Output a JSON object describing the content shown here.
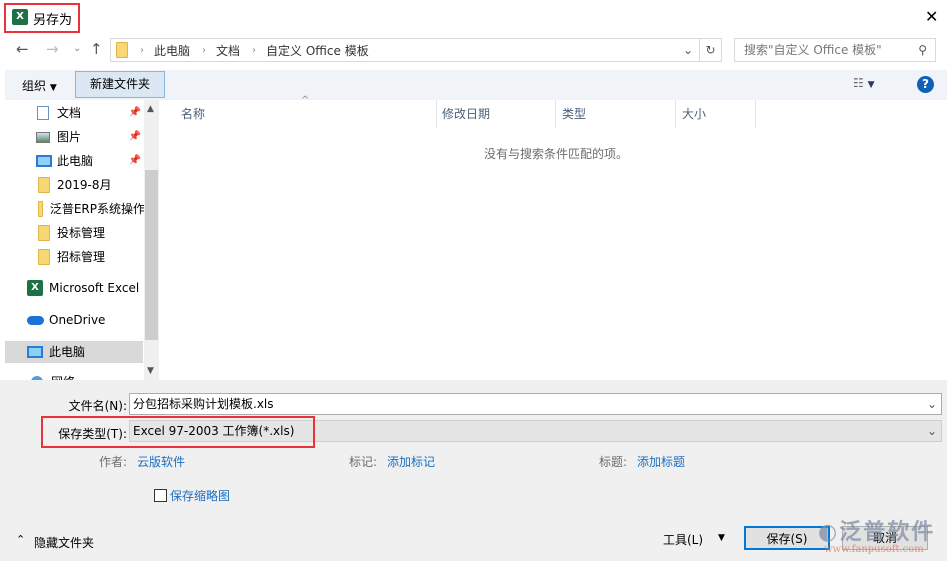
{
  "window": {
    "title": "另存为",
    "close": "✕"
  },
  "address": {
    "crumbs": [
      "此电脑",
      "文档",
      "自定义 Office 模板"
    ],
    "search_placeholder": "搜索\"自定义 Office 模板\""
  },
  "toolbar": {
    "organize": "组织",
    "new_folder": "新建文件夹",
    "help": "?"
  },
  "nav": {
    "items": [
      {
        "label": "文档",
        "icon": "document-icon",
        "pinned": true
      },
      {
        "label": "图片",
        "icon": "picture-icon",
        "pinned": true
      },
      {
        "label": "此电脑",
        "icon": "computer-icon",
        "pinned": true
      },
      {
        "label": "2019-8月",
        "icon": "folder-icon"
      },
      {
        "label": "泛普ERP系统操作",
        "icon": "folder-icon"
      },
      {
        "label": "投标管理",
        "icon": "folder-icon"
      },
      {
        "label": "招标管理",
        "icon": "folder-icon"
      },
      {
        "label": "Microsoft Excel",
        "icon": "excel-icon"
      },
      {
        "label": "OneDrive",
        "icon": "cloud-icon"
      },
      {
        "label": "此电脑",
        "icon": "computer-icon",
        "selected": true
      },
      {
        "label": "网络",
        "icon": "network-icon"
      }
    ]
  },
  "columns": [
    "名称",
    "修改日期",
    "类型",
    "大小"
  ],
  "empty_message": "没有与搜索条件匹配的项。",
  "form": {
    "filename_label": "文件名(N):",
    "filename": "分包招标采购计划模板.xls",
    "type_label": "保存类型(T):",
    "type": "Excel 97-2003 工作簿(*.xls)",
    "author_label": "作者:",
    "author": "云版软件",
    "tags_label": "标记:",
    "tags": "添加标记",
    "title_label": "标题:",
    "title": "添加标题",
    "thumbnail": "保存缩略图"
  },
  "footer": {
    "hide_folders": "隐藏文件夹",
    "tools": "工具(L)",
    "save": "保存(S)",
    "cancel": "取消"
  },
  "watermark": {
    "name": "泛普软件",
    "url": "www.fanpusoft.com"
  },
  "colors": {
    "accent": "#0078d7",
    "highlight": "#e8323c",
    "link": "#1a6fc2"
  }
}
